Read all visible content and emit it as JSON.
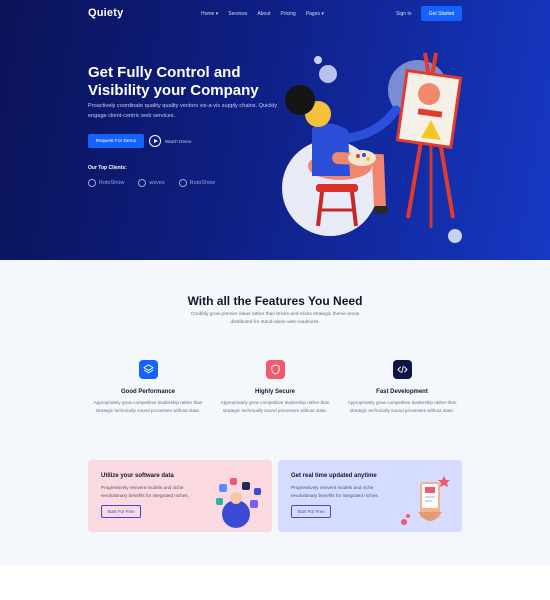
{
  "nav": {
    "logo": "Quiety",
    "links": [
      "Home ▾",
      "Services",
      "About",
      "Pricing",
      "Pages ▾"
    ],
    "signin": "Sign In",
    "cta": "Get Started"
  },
  "hero": {
    "title": "Get Fully Control and Visibility your Company",
    "subtitle": "Proactively coordinate quality quality vectors vis-a-vis supply chains. Quickly engage client-centric web services.",
    "primary_button": "Request For Demo",
    "watch_label": "Watch Demo",
    "clients_label": "Our Top Clients:",
    "clients": [
      "RotoShow",
      "wsves",
      "RotoShow"
    ]
  },
  "features": {
    "title": "With all the Features You Need",
    "subtitle": "Credibly grow premier ideas rather than bricks-and-clicks strategic theme areas distributed for stand-alone web-readiness.",
    "cards": [
      {
        "title": "Good Performance",
        "desc": "Appropriately grow competitive leadership rather than strategic technically sound processes without state.",
        "icon": "layers-icon",
        "color": "#1463ff"
      },
      {
        "title": "Highly Secure",
        "desc": "Appropriately grow competitive leadership rather than strategic technically sound processes without state.",
        "icon": "shield-icon",
        "color": "#f05a6e"
      },
      {
        "title": "Fast Development",
        "desc": "Appropriately grow competitive leadership rather than strategic technically sound processes without state.",
        "icon": "code-icon",
        "color": "#0e1544"
      }
    ],
    "promos": [
      {
        "title": "Utilize your software data",
        "desc": "Progressively reinvent models and niche revolutionary benefits for integrated niches.",
        "button": "Start For Free",
        "bg": "#fbd9e0"
      },
      {
        "title": "Get real time updated anytime",
        "desc": "Progressively reinvent models and niche revolutionary benefits for integrated niches.",
        "button": "Start For Free",
        "bg": "#d6dcff"
      }
    ]
  },
  "colors": {
    "accent": "#1463ff",
    "hero_dark": "#0b1358",
    "hero_light": "#1638c4"
  }
}
